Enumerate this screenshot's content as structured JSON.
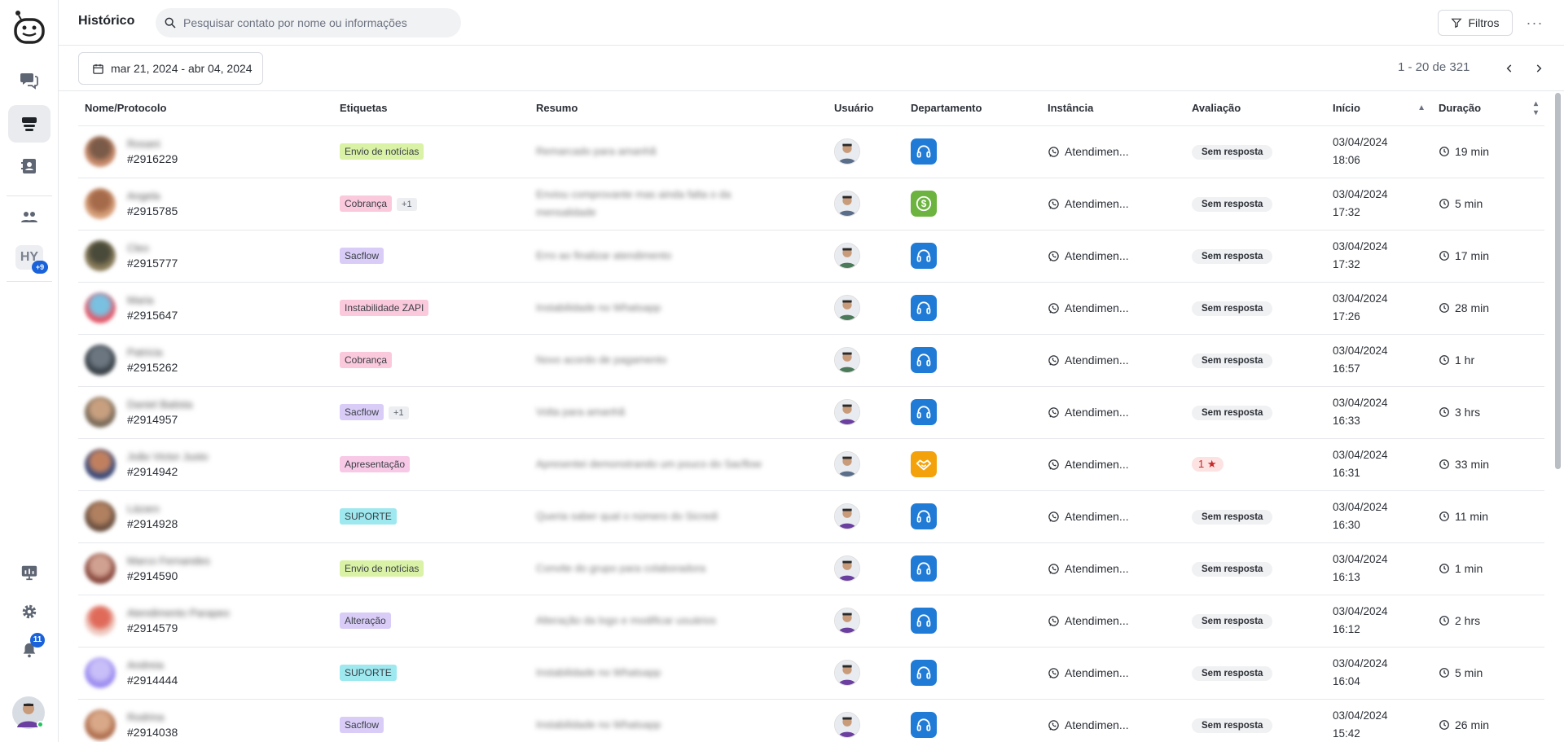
{
  "app": {
    "page_title": "Histórico",
    "search_placeholder": "Pesquisar contato por nome ou informações",
    "filters_label": "Filtros",
    "date_range": "mar 21, 2024 - abr 04, 2024",
    "pagination": "1 - 20 de 321"
  },
  "sidebar": {
    "hy_label": "HY",
    "hy_badge": "+9",
    "notifications_badge": "11"
  },
  "columns": {
    "name": "Nome/Protocolo",
    "tags": "Etiquetas",
    "summary": "Resumo",
    "user": "Usuário",
    "department": "Departamento",
    "instance": "Instância",
    "rating": "Avaliação",
    "start": "Início",
    "duration": "Duração"
  },
  "colors": {
    "accent": "#1a62d9",
    "dept_support": "#1f7bd6",
    "dept_finance": "#6cb33f",
    "dept_sales": "#f4a20c"
  },
  "rows": [
    {
      "name": "Rosani",
      "protocol": "#2916229",
      "tag": "Envio de notícias",
      "tag_color": "#d9f2a6",
      "tag_extra": "",
      "summary": "Remarcado para amanhã",
      "dept_icon": "headset-icon",
      "dept_color": "#1f7bd6",
      "instance": "Atendimen...",
      "rating": "Sem resposta",
      "date": "03/04/2024",
      "time": "18:06",
      "duration": "19 min"
    },
    {
      "name": "Angela",
      "protocol": "#2915785",
      "tag": "Cobrança",
      "tag_color": "#fbc9dc",
      "tag_extra": "+1",
      "summary": "Enviou comprovante mas ainda falta o da mensalidade",
      "dept_icon": "dollar-icon",
      "dept_color": "#6cb33f",
      "instance": "Atendimen...",
      "rating": "Sem resposta",
      "date": "03/04/2024",
      "time": "17:32",
      "duration": "5 min"
    },
    {
      "name": "Cleo",
      "protocol": "#2915777",
      "tag": "Sacflow",
      "tag_color": "#d9cdf7",
      "tag_extra": "",
      "summary": "Erro ao finalizar atendimento",
      "dept_icon": "headset-icon",
      "dept_color": "#1f7bd6",
      "instance": "Atendimen...",
      "rating": "Sem resposta",
      "date": "03/04/2024",
      "time": "17:32",
      "duration": "17 min"
    },
    {
      "name": "Maria",
      "protocol": "#2915647",
      "tag": "Instabilidade ZAPI",
      "tag_color": "#fbc9dc",
      "tag_extra": "",
      "summary": "Instabilidade no Whatsapp",
      "dept_icon": "headset-icon",
      "dept_color": "#1f7bd6",
      "instance": "Atendimen...",
      "rating": "Sem resposta",
      "date": "03/04/2024",
      "time": "17:26",
      "duration": "28 min"
    },
    {
      "name": "Patricia",
      "protocol": "#2915262",
      "tag": "Cobrança",
      "tag_color": "#fbc9dc",
      "tag_extra": "",
      "summary": "Novo acordo de pagamento",
      "dept_icon": "headset-icon",
      "dept_color": "#1f7bd6",
      "instance": "Atendimen...",
      "rating": "Sem resposta",
      "date": "03/04/2024",
      "time": "16:57",
      "duration": "1 hr"
    },
    {
      "name": "Daniel Batista",
      "protocol": "#2914957",
      "tag": "Sacflow",
      "tag_color": "#d9cdf7",
      "tag_extra": "+1",
      "summary": "Volta para amanhã",
      "dept_icon": "headset-icon",
      "dept_color": "#1f7bd6",
      "instance": "Atendimen...",
      "rating": "Sem resposta",
      "date": "03/04/2024",
      "time": "16:33",
      "duration": "3 hrs"
    },
    {
      "name": "João Victor Justo",
      "protocol": "#2914942",
      "tag": "Apresentação",
      "tag_color": "#f8c9e6",
      "tag_extra": "",
      "summary": "Apresentei demonstrando um pouco do Sacflow",
      "dept_icon": "handshake-icon",
      "dept_color": "#f4a20c",
      "instance": "Atendimen...",
      "rating": "1 ★",
      "date": "03/04/2024",
      "time": "16:31",
      "duration": "33 min"
    },
    {
      "name": "Lázaro",
      "protocol": "#2914928",
      "tag": "SUPORTE",
      "tag_color": "#9ee8ef",
      "tag_extra": "",
      "summary": "Queria saber qual o número do Sicredi",
      "dept_icon": "headset-icon",
      "dept_color": "#1f7bd6",
      "instance": "Atendimen...",
      "rating": "Sem resposta",
      "date": "03/04/2024",
      "time": "16:30",
      "duration": "11 min"
    },
    {
      "name": "Marco Fernandes",
      "protocol": "#2914590",
      "tag": "Envio de notícias",
      "tag_color": "#d9f2a6",
      "tag_extra": "",
      "summary": "Convite do grupo para colaboradora",
      "dept_icon": "headset-icon",
      "dept_color": "#1f7bd6",
      "instance": "Atendimen...",
      "rating": "Sem resposta",
      "date": "03/04/2024",
      "time": "16:13",
      "duration": "1 min"
    },
    {
      "name": "Atendimento Parapeo",
      "protocol": "#2914579",
      "tag": "Alteração",
      "tag_color": "#d9cdf7",
      "tag_extra": "",
      "summary": "Alteração da logo e modificar usuários",
      "dept_icon": "headset-icon",
      "dept_color": "#1f7bd6",
      "instance": "Atendimen...",
      "rating": "Sem resposta",
      "date": "03/04/2024",
      "time": "16:12",
      "duration": "2 hrs"
    },
    {
      "name": "Andreia",
      "protocol": "#2914444",
      "tag": "SUPORTE",
      "tag_color": "#9ee8ef",
      "tag_extra": "",
      "summary": "Instabilidade no Whatsapp",
      "dept_icon": "headset-icon",
      "dept_color": "#1f7bd6",
      "instance": "Atendimen...",
      "rating": "Sem resposta",
      "date": "03/04/2024",
      "time": "16:04",
      "duration": "5 min"
    },
    {
      "name": "Rodrina",
      "protocol": "#2914038",
      "tag": "Sacflow",
      "tag_color": "#d9cdf7",
      "tag_extra": "",
      "summary": "Instabilidade no Whatsapp",
      "dept_icon": "headset-icon",
      "dept_color": "#1f7bd6",
      "instance": "Atendimen...",
      "rating": "Sem resposta",
      "date": "03/04/2024",
      "time": "15:42",
      "duration": "26 min"
    }
  ]
}
